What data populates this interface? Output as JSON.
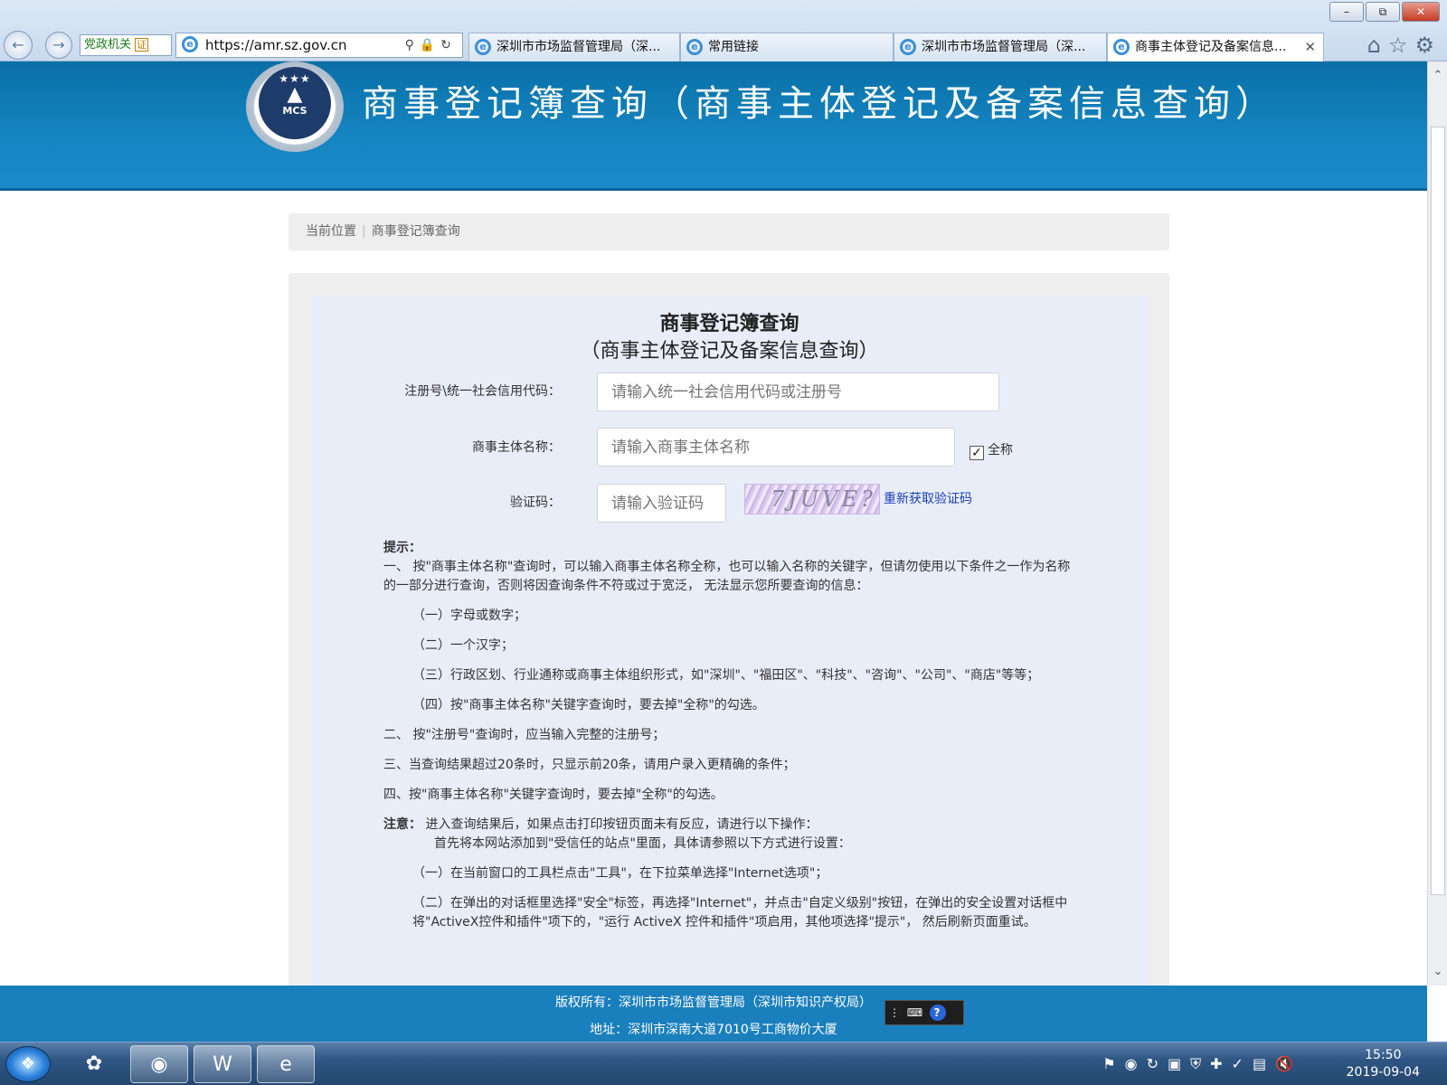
{
  "browser": {
    "address_tag": "党政机关",
    "address_tag_badge": "证",
    "url": "https://amr.sz.gov.cn",
    "tabs": [
      {
        "label": "深圳市市场监督管理局（深..."
      },
      {
        "label": "常用链接"
      },
      {
        "label": "深圳市市场监督管理局（深..."
      },
      {
        "label": "商事主体登记及备案信息..."
      }
    ],
    "close_glyph": "✕"
  },
  "header": {
    "logo_text": "MCS",
    "title": "商事登记簿查询（商事主体登记及备案信息查询）"
  },
  "breadcrumb": {
    "current_label": "当前位置",
    "page": "商事登记簿查询"
  },
  "form": {
    "title": "商事登记簿查询",
    "subtitle": "（商事主体登记及备案信息查询）",
    "code_label": "注册号\\统一社会信用代码：",
    "code_placeholder": "请输入统一社会信用代码或注册号",
    "name_label": "商事主体名称：",
    "name_placeholder": "请输入商事主体名称",
    "fullname_label": "全称",
    "fullname_checked": true,
    "captcha_label": "验证码：",
    "captcha_placeholder": "请输入验证码",
    "captcha_text": "7JUVE?",
    "refresh_label": "重新获取验证码"
  },
  "tips": {
    "heading": "提示：",
    "p1": "一、 按\"商事主体名称\"查询时，可以输入商事主体名称全称，也可以输入名称的关键字，但请勿使用以下条件之一作为名称的一部分进行查询，否则将因查询条件不符或过于宽泛， 无法显示您所要查询的信息：",
    "s1": "（一）字母或数字；",
    "s2": "（二）一个汉字；",
    "s3": "（三）行政区划、行业通称或商事主体组织形式，如\"深圳\"、\"福田区\"、\"科技\"、\"咨询\"、\"公司\"、\"商店\"等等；",
    "s4": "（四）按\"商事主体名称\"关键字查询时，要去掉\"全称\"的勾选。",
    "p2": "二、 按\"注册号\"查询时，应当输入完整的注册号；",
    "p3": "三、当查询结果超过20条时，只显示前20条，请用户录入更精确的条件；",
    "p4": "四、按\"商事主体名称\"关键字查询时，要去掉\"全称\"的勾选。",
    "note_heading": "注意：",
    "note_text": "进入查询结果后，如果点击打印按钮页面未有反应，请进行以下操作：",
    "note_text2": "首先将本网站添加到\"受信任的站点\"里面，具体请参照以下方式进行设置：",
    "n1": "（一）在当前窗口的工具栏点击\"工具\"，在下拉菜单选择\"Internet选项\"；",
    "n2": "（二）在弹出的对话框里选择\"安全\"标签，再选择\"Internet\"，并点击\"自定义级别\"按钮，在弹出的安全设置对话框中将\"ActiveX控件和插件\"项下的，\"运行 ActiveX 控件和插件\"项启用，其他项选择\"提示\"， 然后刷新页面重试。"
  },
  "footer": {
    "copyright": "版权所有：深圳市市场监督管理局（深圳市知识产权局）",
    "address": "地址：深圳市深南大道7010号工商物价大厦"
  },
  "taskbar": {
    "time": "15:50",
    "date": "2019-09-04"
  },
  "icons": [
    "back-icon",
    "forward-icon",
    "search-icon",
    "lock-icon",
    "refresh-icon",
    "home-icon",
    "star-icon",
    "gear-icon",
    "ie-icon",
    "windows-start-icon",
    "wechat-icon",
    "word-icon"
  ]
}
